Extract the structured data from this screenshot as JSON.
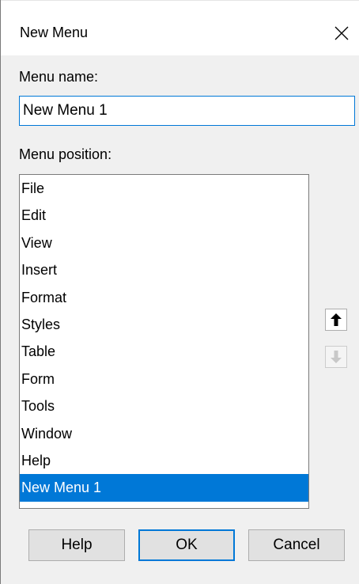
{
  "window": {
    "title": "New Menu"
  },
  "form": {
    "menu_name_label": "Menu name:",
    "menu_name_value": "New Menu 1",
    "menu_position_label": "Menu position:"
  },
  "menu_positions": [
    "File",
    "Edit",
    "View",
    "Insert",
    "Format",
    "Styles",
    "Table",
    "Form",
    "Tools",
    "Window",
    "Help",
    "New Menu 1"
  ],
  "selected_position": "New Menu 1",
  "buttons": {
    "help": "Help",
    "ok": "OK",
    "cancel": "Cancel"
  },
  "icons": {
    "close": "close-icon",
    "move_up": "arrow-up-icon",
    "move_down": "arrow-down-icon"
  },
  "colors": {
    "accent": "#0078d7",
    "dialog_background": "#f0f0f0",
    "disabled_arrow": "#c8c8c8"
  }
}
